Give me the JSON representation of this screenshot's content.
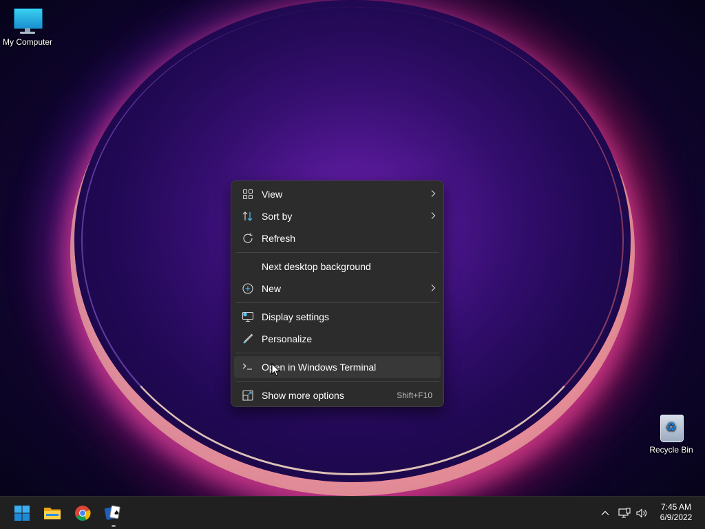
{
  "desktop": {
    "icons": [
      {
        "label": "My Computer",
        "icon": "monitor-icon"
      },
      {
        "label": "Recycle Bin",
        "icon": "recycle-bin-icon"
      }
    ]
  },
  "context_menu": {
    "items": [
      {
        "label": "View",
        "icon": "grid-icon",
        "has_submenu": true
      },
      {
        "label": "Sort by",
        "icon": "sort-icon",
        "has_submenu": true
      },
      {
        "label": "Refresh",
        "icon": "refresh-icon",
        "has_submenu": false
      },
      {
        "label": "Next desktop background",
        "icon": "",
        "has_submenu": false
      },
      {
        "label": "New",
        "icon": "plus-circle-icon",
        "has_submenu": true
      },
      {
        "label": "Display settings",
        "icon": "display-icon",
        "has_submenu": false
      },
      {
        "label": "Personalize",
        "icon": "pen-icon",
        "has_submenu": false
      },
      {
        "label": "Open in Windows Terminal",
        "icon": "terminal-icon",
        "has_submenu": false,
        "hovered": true
      },
      {
        "label": "Show more options",
        "icon": "expand-icon",
        "shortcut": "Shift+F10"
      }
    ]
  },
  "taskbar": {
    "apps": [
      {
        "name": "Start",
        "icon": "windows-logo-icon"
      },
      {
        "name": "File Explorer",
        "icon": "folder-icon"
      },
      {
        "name": "Google Chrome",
        "icon": "chrome-icon"
      },
      {
        "name": "Solitaire",
        "icon": "cards-icon",
        "running": true
      }
    ],
    "tray": [
      "chevron-up-icon",
      "network-icon",
      "volume-icon"
    ],
    "clock": {
      "time": "7:45 AM",
      "date": "6/9/2022"
    }
  },
  "colors": {
    "menu_bg": "#2c2c2c",
    "menu_hover": "#383838",
    "taskbar_bg": "#202020",
    "accent_blue": "#4cc2ff"
  }
}
